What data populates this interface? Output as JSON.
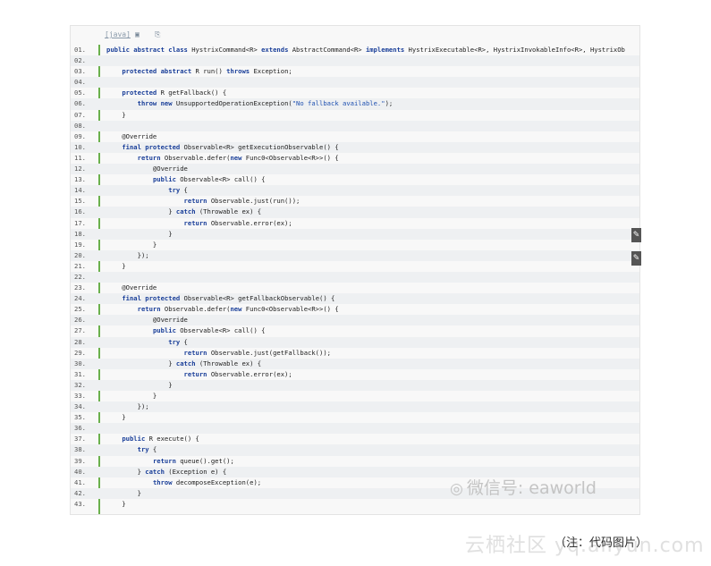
{
  "code_block": {
    "lang_label": "[java]",
    "lines": [
      {
        "num": "01.",
        "text": "public abstract class HystrixCommand<R> extends AbstractCommand<R> implements HystrixExecutable<R>, HystrixInvokableInfo<R>, HystrixOb"
      },
      {
        "num": "02.",
        "text": ""
      },
      {
        "num": "03.",
        "text": "    protected abstract R run() throws Exception;"
      },
      {
        "num": "04.",
        "text": ""
      },
      {
        "num": "05.",
        "text": "    protected R getFallback() {"
      },
      {
        "num": "06.",
        "text": "        throw new UnsupportedOperationException(\"No fallback available.\");"
      },
      {
        "num": "07.",
        "text": "    }"
      },
      {
        "num": "08.",
        "text": ""
      },
      {
        "num": "09.",
        "text": "    @Override"
      },
      {
        "num": "10.",
        "text": "    final protected Observable<R> getExecutionObservable() {"
      },
      {
        "num": "11.",
        "text": "        return Observable.defer(new Func0<Observable<R>>() {"
      },
      {
        "num": "12.",
        "text": "            @Override"
      },
      {
        "num": "13.",
        "text": "            public Observable<R> call() {"
      },
      {
        "num": "14.",
        "text": "                try {"
      },
      {
        "num": "15.",
        "text": "                    return Observable.just(run());"
      },
      {
        "num": "16.",
        "text": "                } catch (Throwable ex) {"
      },
      {
        "num": "17.",
        "text": "                    return Observable.error(ex);"
      },
      {
        "num": "18.",
        "text": "                }"
      },
      {
        "num": "19.",
        "text": "            }"
      },
      {
        "num": "20.",
        "text": "        });"
      },
      {
        "num": "21.",
        "text": "    }"
      },
      {
        "num": "22.",
        "text": ""
      },
      {
        "num": "23.",
        "text": "    @Override"
      },
      {
        "num": "24.",
        "text": "    final protected Observable<R> getFallbackObservable() {"
      },
      {
        "num": "25.",
        "text": "        return Observable.defer(new Func0<Observable<R>>() {"
      },
      {
        "num": "26.",
        "text": "            @Override"
      },
      {
        "num": "27.",
        "text": "            public Observable<R> call() {"
      },
      {
        "num": "28.",
        "text": "                try {"
      },
      {
        "num": "29.",
        "text": "                    return Observable.just(getFallback());"
      },
      {
        "num": "30.",
        "text": "                } catch (Throwable ex) {"
      },
      {
        "num": "31.",
        "text": "                    return Observable.error(ex);"
      },
      {
        "num": "32.",
        "text": "                }"
      },
      {
        "num": "33.",
        "text": "            }"
      },
      {
        "num": "34.",
        "text": "        });"
      },
      {
        "num": "35.",
        "text": "    }"
      },
      {
        "num": "36.",
        "text": ""
      },
      {
        "num": "37.",
        "text": "    public R execute() {"
      },
      {
        "num": "38.",
        "text": "        try {"
      },
      {
        "num": "39.",
        "text": "            return queue().get();"
      },
      {
        "num": "40.",
        "text": "        } catch (Exception e) {"
      },
      {
        "num": "41.",
        "text": "            throw decomposeException(e);"
      },
      {
        "num": "42.",
        "text": "        }"
      },
      {
        "num": "43.",
        "text": "    }"
      }
    ]
  },
  "watermark": {
    "text": "微信号: eaworld"
  },
  "caption": {
    "text": "（注：代码图片）"
  },
  "watermark_site": {
    "text": "云栖社区 yq.aliyun.com"
  },
  "colors": {
    "gutter": "#6ab04c",
    "keyword": "#1a3f99",
    "string": "#1d4fb0"
  }
}
